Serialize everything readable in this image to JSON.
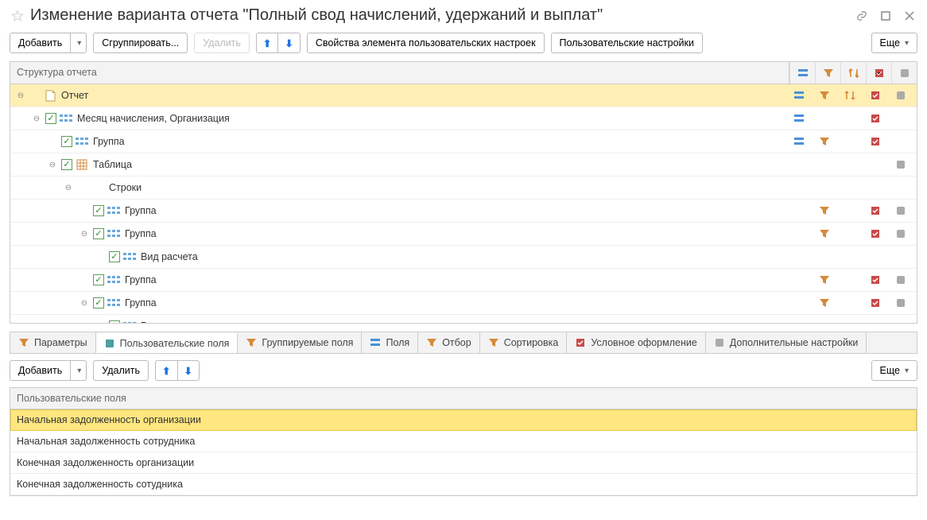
{
  "title": "Изменение варианта отчета \"Полный свод начислений, удержаний и выплат\"",
  "toolbar": {
    "add": "Добавить",
    "group": "Сгруппировать...",
    "delete": "Удалить",
    "props": "Свойства элемента пользовательских настроек",
    "user_settings": "Пользовательские настройки",
    "more": "Еще"
  },
  "tree": {
    "header": "Структура отчета",
    "rows": [
      {
        "indent": 0,
        "exp": "−",
        "check": false,
        "doc_icon": true,
        "icon": "",
        "label": "Отчет",
        "highlight": true,
        "icons": [
          "blue",
          "orange",
          "orange2",
          "red",
          "grey"
        ]
      },
      {
        "indent": 1,
        "exp": "−",
        "check": true,
        "icon": "fields",
        "label": "Месяц начисления, Организация",
        "icons": [
          "blue",
          "",
          "",
          "red",
          ""
        ]
      },
      {
        "indent": 2,
        "exp": "",
        "check": true,
        "icon": "fields",
        "label": "Группа",
        "icons": [
          "blue",
          "orange",
          "",
          "red",
          ""
        ]
      },
      {
        "indent": 2,
        "exp": "−",
        "check": true,
        "icon": "table",
        "label": "Таблица",
        "icons": [
          "",
          "",
          "",
          "",
          "grey"
        ]
      },
      {
        "indent": 3,
        "exp": "−",
        "check": false,
        "icon": "",
        "label": "Строки",
        "icons": [
          "",
          "",
          "",
          "",
          ""
        ]
      },
      {
        "indent": 4,
        "exp": "",
        "check": true,
        "icon": "fields",
        "label": "Группа",
        "icons": [
          "",
          "orange",
          "",
          "red",
          "grey"
        ]
      },
      {
        "indent": 4,
        "exp": "−",
        "check": true,
        "icon": "fields",
        "label": "Группа",
        "icons": [
          "",
          "orange",
          "",
          "red",
          "grey"
        ]
      },
      {
        "indent": 5,
        "exp": "",
        "check": true,
        "icon": "fields",
        "label": "Вид расчета",
        "icons": [
          "",
          "",
          "",
          "",
          ""
        ]
      },
      {
        "indent": 4,
        "exp": "",
        "check": true,
        "icon": "fields",
        "label": "Группа",
        "icons": [
          "",
          "orange",
          "",
          "red",
          "grey"
        ]
      },
      {
        "indent": 4,
        "exp": "−",
        "check": true,
        "icon": "fields",
        "label": "Группа",
        "icons": [
          "",
          "orange",
          "",
          "red",
          "grey"
        ]
      },
      {
        "indent": 5,
        "exp": "",
        "check": true,
        "icon": "fields",
        "label": "Вид расчета",
        "icons": [
          "",
          "",
          "",
          "",
          ""
        ]
      }
    ]
  },
  "tabs": [
    {
      "label": "Параметры",
      "icon": "orange"
    },
    {
      "label": "Пользовательские поля",
      "icon": "teal",
      "active": true
    },
    {
      "label": "Группируемые поля",
      "icon": "orange"
    },
    {
      "label": "Поля",
      "icon": "blue"
    },
    {
      "label": "Отбор",
      "icon": "orange"
    },
    {
      "label": "Сортировка",
      "icon": "orange"
    },
    {
      "label": "Условное оформление",
      "icon": "red"
    },
    {
      "label": "Дополнительные настройки",
      "icon": "grey"
    }
  ],
  "toolbar2": {
    "add": "Добавить",
    "delete": "Удалить",
    "more": "Еще"
  },
  "lower": {
    "header": "Пользовательские поля",
    "rows": [
      {
        "label": "Начальная задолженность организации",
        "selected": true
      },
      {
        "label": "Начальная задолженность сотрудника"
      },
      {
        "label": "Конечная задолженность организации"
      },
      {
        "label": "Конечная задолженность сотудника"
      }
    ]
  }
}
